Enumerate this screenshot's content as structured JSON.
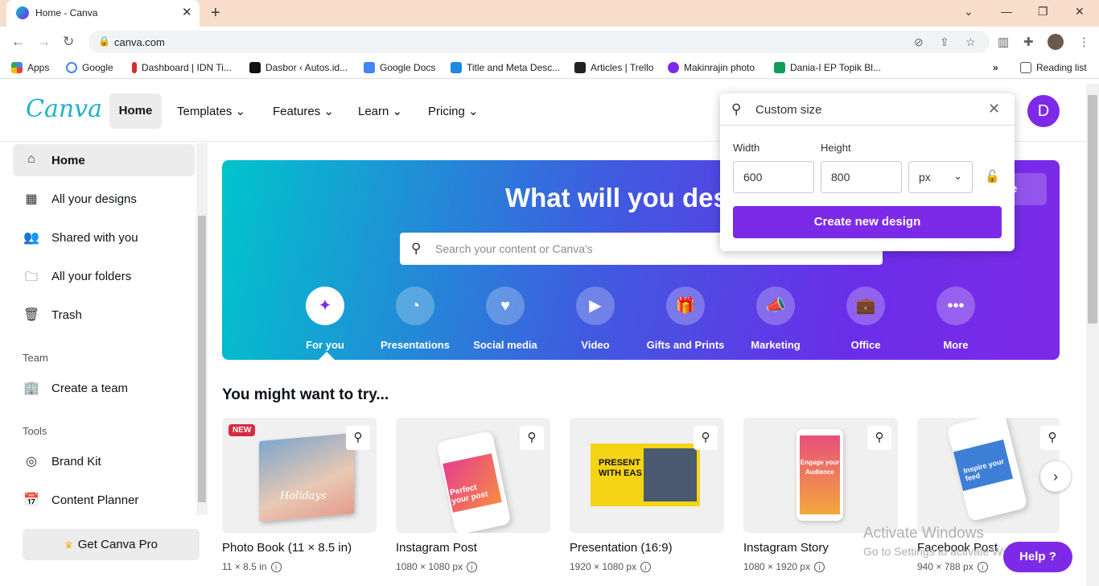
{
  "browser": {
    "tab_title": "Home - Canva",
    "url": "canva.com",
    "bookmarks": [
      "Apps",
      "Google",
      "Dashboard | IDN Ti...",
      "Dasbor ‹ Autos.id...",
      "Google Docs",
      "Title and Meta Desc...",
      "Articles | Trello",
      "Makinrajin photo",
      "Dania-I EP Topik Bl..."
    ],
    "reading_list": "Reading list"
  },
  "header": {
    "logo": "Canva",
    "nav": [
      "Home",
      "Templates",
      "Features",
      "Learn",
      "Pricing"
    ],
    "user_initial": "D"
  },
  "sidebar": {
    "items": [
      "Home",
      "All your designs",
      "Shared with you",
      "All your folders",
      "Trash"
    ],
    "team_heading": "Team",
    "team_items": [
      "Create a team"
    ],
    "tools_heading": "Tools",
    "tools_items": [
      "Brand Kit",
      "Content Planner"
    ],
    "pro_label": "Get Canva Pro"
  },
  "hero": {
    "title": "What will you des",
    "custom_size_partial": "size",
    "search_placeholder": "Search your content or Canva's",
    "categories": [
      "For you",
      "Presentations",
      "Social media",
      "Video",
      "Gifts and Prints",
      "Marketing",
      "Office",
      "More"
    ]
  },
  "try_section": {
    "title": "You might want to try...",
    "new_badge": "NEW",
    "cards": [
      {
        "name": "Photo Book (11 × 8.5 in)",
        "size": "11 × 8.5 in"
      },
      {
        "name": "Instagram Post",
        "size": "1080 × 1080 px"
      },
      {
        "name": "Presentation (16:9)",
        "size": "1920 × 1080 px"
      },
      {
        "name": "Instagram Story",
        "size": "1080 × 1920 px"
      },
      {
        "name": "Facebook Post",
        "size": "940 × 788 px"
      }
    ],
    "thumb_texts": [
      "Holidays",
      "Perfect your post",
      "PRESENT WITH EAS",
      "Engage your Audience",
      "Inspire your feed"
    ]
  },
  "popup": {
    "query": "Custom size",
    "width_label": "Width",
    "height_label": "Height",
    "width_value": "600",
    "height_value": "800",
    "unit": "px",
    "create_label": "Create new design"
  },
  "watermark": {
    "line1": "Activate Windows",
    "line2": "Go to Settings to activate Windows."
  },
  "help_label": "Help ?",
  "colors": {
    "accent": "#7d2ae8",
    "teal": "#00c4cc"
  }
}
